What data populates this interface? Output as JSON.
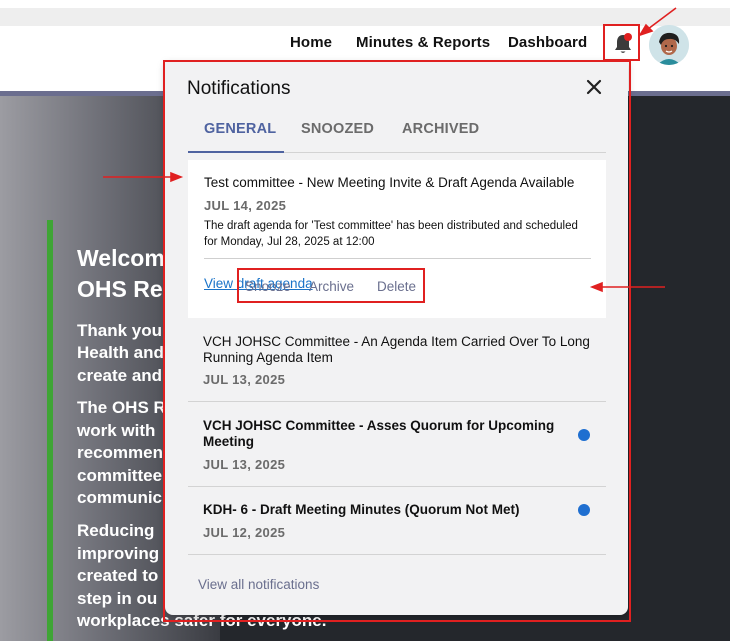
{
  "nav": {
    "home": "Home",
    "minutes_reports": "Minutes & Reports",
    "dashboard": "Dashboard"
  },
  "icons": {
    "bell": "bell-icon",
    "close": "close-icon",
    "avatar": "user-avatar"
  },
  "colors": {
    "accent": "#4f63a0",
    "link": "#1a73c8",
    "unread_dot": "#1f6fd0",
    "annotation": "#e02020",
    "hero_stripe": "#3fa535"
  },
  "hero": {
    "line1": "Welcom",
    "line2": "OHS Res",
    "p1_line1": "Thank you",
    "p1_line2": "Health and",
    "p1_line3": "create and",
    "p2_line1": "The OHS R",
    "p2_line2": "work with",
    "p2_line3": "recommen",
    "p2_line4": "committee",
    "p2_line5": "communic",
    "p3_line1": "Reducing",
    "p3_line2": "improving",
    "p3_line3": "created to",
    "p3_line4": "step in ou",
    "p3_line5": "workplaces safer for everyone."
  },
  "panel": {
    "title": "Notifications",
    "tabs": [
      {
        "label": "GENERAL",
        "active": true
      },
      {
        "label": "SNOOZED",
        "active": false
      },
      {
        "label": "ARCHIVED",
        "active": false
      }
    ],
    "items": [
      {
        "title": "Test committee - New Meeting Invite & Draft Agenda Available",
        "date": "JUL 14, 2025",
        "desc_line1": "The draft agenda for 'Test committee' has been distributed and scheduled",
        "desc_line2": "for Monday, Jul 28, 2025 at 12:00",
        "link": "View draft agenda",
        "actions": {
          "snooze": "Snooze",
          "archive": "Archive",
          "delete": "Delete"
        },
        "unread": false
      },
      {
        "title_line1": "VCH JOHSC Committee - An Agenda Item Carried Over To Long",
        "title_line2": "Running Agenda Item",
        "date": "JUL 13, 2025",
        "unread": false
      },
      {
        "title_line1": "VCH JOHSC Committee - Asses Quorum for Upcoming",
        "title_line2": "Meeting",
        "date": "JUL 13, 2025",
        "unread": true
      },
      {
        "title": "KDH- 6 - Draft Meeting Minutes (Quorum Not Met)",
        "date": "JUL 12, 2025",
        "unread": true
      }
    ],
    "view_all": "View all notifications"
  }
}
